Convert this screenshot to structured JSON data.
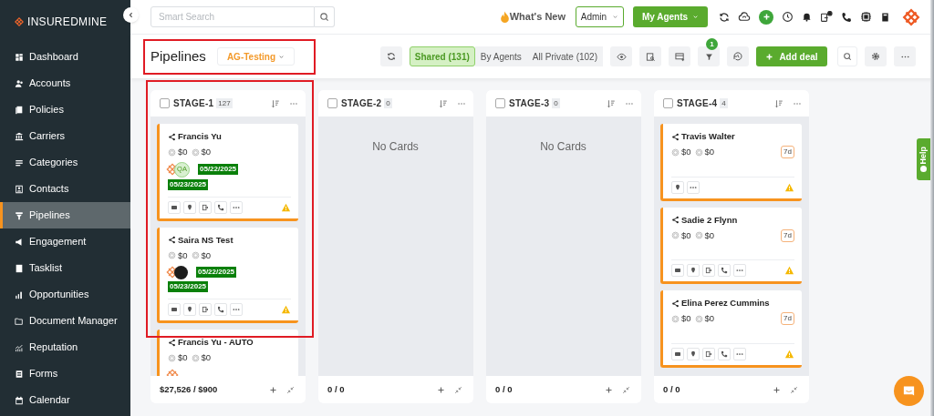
{
  "sidebar": {
    "logo": "**INSURED**MINE",
    "items": [
      {
        "label": "Dashboard",
        "selected": false
      },
      {
        "label": "Accounts",
        "selected": false
      },
      {
        "label": "Policies",
        "selected": false
      },
      {
        "label": "Carriers",
        "selected": false
      },
      {
        "label": "Categories",
        "selected": false
      },
      {
        "label": "Contacts",
        "selected": false
      },
      {
        "label": "Pipelines",
        "selected": true
      },
      {
        "label": "Engagement",
        "selected": false
      },
      {
        "label": "Tasklist",
        "selected": false
      },
      {
        "label": "Opportunities",
        "selected": false
      },
      {
        "label": "Document Manager",
        "selected": false
      },
      {
        "label": "Reputation",
        "selected": false
      },
      {
        "label": "Forms",
        "selected": false
      },
      {
        "label": "Calendar",
        "selected": false
      }
    ]
  },
  "topbar": {
    "search": {
      "placeholder": "Smart Search"
    },
    "whats_new": "What's New",
    "role": "Admin",
    "agents_button": "My Agents"
  },
  "toolbar": {
    "title": "Pipelines",
    "pipeline": "AG-Testing",
    "views": [
      {
        "label": "Shared (131)",
        "selected": true
      },
      {
        "label": "By Agents",
        "selected": false
      },
      {
        "label": "All Private (102)",
        "selected": false
      }
    ],
    "filter_badge": "1",
    "add_button": "Add deal"
  },
  "stages": [
    {
      "name": "STAGE-1",
      "count": "127",
      "total": "$27,526 / $900",
      "cards": [
        {
          "name": "Francis Yu",
          "amounts": [
            "$0",
            "$0"
          ],
          "avatars": [
            {
              "kind": "logo"
            },
            {
              "kind": "initials",
              "text": "QA"
            }
          ],
          "dates": [
            "05/22/2025",
            "05/23/2025"
          ],
          "actions": [
            {
              "kind": "email"
            },
            {
              "kind": "pin"
            },
            {
              "kind": "exit"
            },
            {
              "kind": "phone"
            },
            {
              "kind": "more"
            }
          ],
          "warning": true
        },
        {
          "name": "Saira NS Test",
          "amounts": [
            "$0",
            "$0"
          ],
          "avatars": [
            {
              "kind": "logo"
            },
            {
              "kind": "photo"
            }
          ],
          "dates": [
            "05/22/2025",
            "05/23/2025"
          ],
          "actions": [
            {
              "kind": "email"
            },
            {
              "kind": "pin"
            },
            {
              "kind": "exit"
            },
            {
              "kind": "phone"
            },
            {
              "kind": "more"
            }
          ],
          "warning": true
        },
        {
          "name": "Francis Yu - AUTO",
          "amounts": [
            "$0",
            "$0"
          ],
          "avatars": [
            {
              "kind": "logo"
            }
          ]
        }
      ],
      "checked": false
    },
    {
      "name": "STAGE-2",
      "count": "0",
      "total": "0 / 0",
      "empty_text": "No Cards",
      "checked": false
    },
    {
      "name": "STAGE-3",
      "count": "0",
      "total": "0 / 0",
      "empty_text": "No Cards",
      "checked": false
    },
    {
      "name": "STAGE-4",
      "count": "4",
      "total": "0 / 0",
      "checked": false,
      "cards": [
        {
          "name": "Travis Walter",
          "amounts": [
            "$0",
            "$0"
          ],
          "age": "7d",
          "actions": [
            {
              "kind": "pin"
            },
            {
              "kind": "more"
            }
          ],
          "warning": true
        },
        {
          "name": "Sadie 2 Flynn",
          "amounts": [
            "$0",
            "$0"
          ],
          "age": "7d",
          "actions": [
            {
              "kind": "email"
            },
            {
              "kind": "pin"
            },
            {
              "kind": "exit"
            },
            {
              "kind": "phone"
            },
            {
              "kind": "more"
            }
          ],
          "warning": true
        },
        {
          "name": "Elina Perez Cummins",
          "amounts": [
            "$0",
            "$0"
          ],
          "age": "7d",
          "actions": [
            {
              "kind": "email"
            },
            {
              "kind": "pin"
            },
            {
              "kind": "exit"
            },
            {
              "kind": "phone"
            },
            {
              "kind": "more"
            }
          ],
          "warning": true
        }
      ]
    }
  ],
  "help_tab": "Help"
}
